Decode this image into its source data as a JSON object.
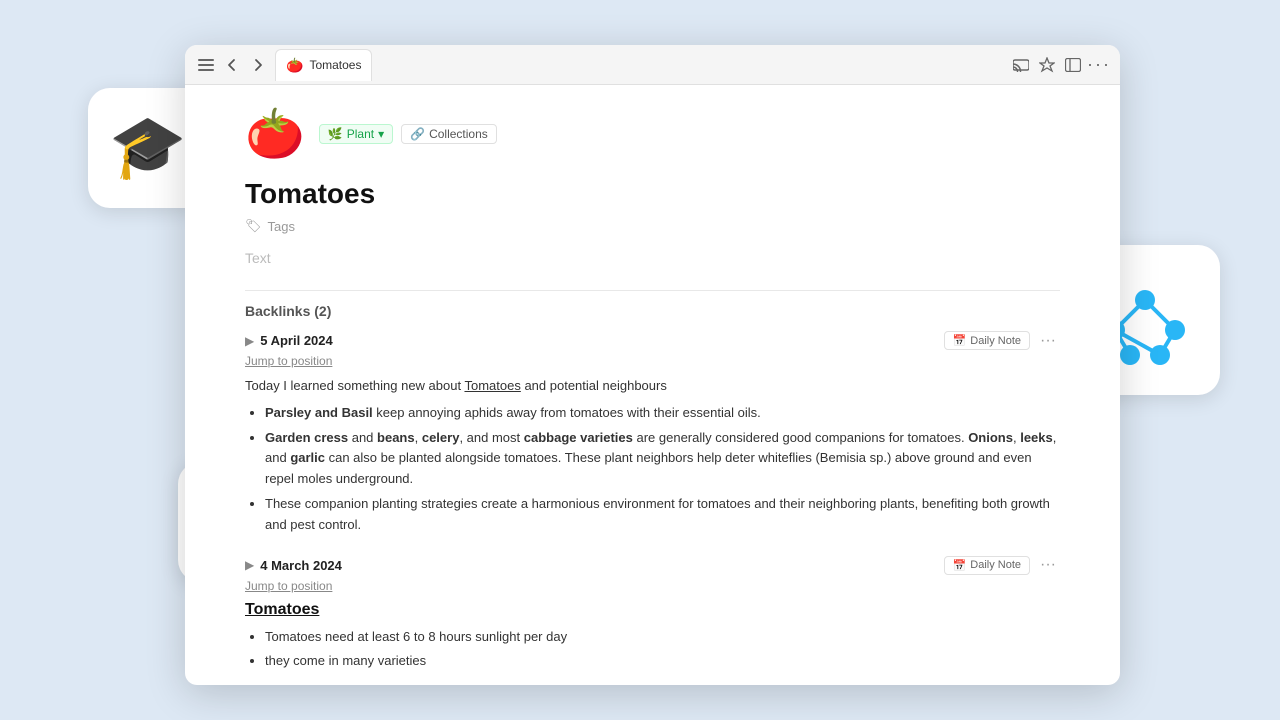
{
  "background_color": "#dde8f4",
  "browser": {
    "tab_label": "Tomatoes",
    "tab_emoji": "🍅",
    "toolbar_icons": [
      "menu",
      "back",
      "forward"
    ],
    "right_icons": [
      "cast",
      "star",
      "sidebar",
      "more"
    ]
  },
  "page": {
    "emoji": "🍅",
    "badge_plant": "Plant",
    "badge_plant_chevron": "▾",
    "badge_collections": "Collections",
    "badge_collections_icon": "🔗",
    "title": "Tomatoes",
    "tags_label": "Tags",
    "text_placeholder": "Text"
  },
  "backlinks": {
    "header": "Backlinks (2)",
    "entries": [
      {
        "date": "5 April 2024",
        "badge": "Daily Note",
        "jump_text": "Jump to position",
        "intro": "Today I learned something new about Tomatoes and potential neighbours",
        "intro_link": "Tomatoes",
        "bullets": [
          {
            "html": "<b>Parsley and Basil</b> keep annoying aphids away from tomatoes with their essential oils."
          },
          {
            "html": "<b>Garden cress</b> and <b>beans</b>, <b>celery</b>, and most <b>cabbage varieties</b> are generally considered good companions for tomatoes. <b>Onions</b>, <b>leeks</b>, and <b>garlic</b> can also be planted alongside tomatoes. These plant neighbors help deter whiteflies (Bemisia sp.) above ground and even repel moles underground."
          },
          {
            "html": "These companion planting strategies create a harmonious environment for tomatoes and their neighboring plants, benefiting both growth and pest control."
          }
        ]
      },
      {
        "date": "4 March 2024",
        "badge": "Daily Note",
        "jump_text": "Jump to position",
        "subtitle": "Tomatoes",
        "bullets": [
          {
            "html": "Tomatoes need at least 6 to 8 hours sunlight per day"
          },
          {
            "html": "they come in many varieties"
          }
        ]
      }
    ]
  },
  "floating_icons": {
    "graduation": "🎓",
    "graph_label": "graph-icon",
    "terminal_label": "terminal-icon"
  }
}
